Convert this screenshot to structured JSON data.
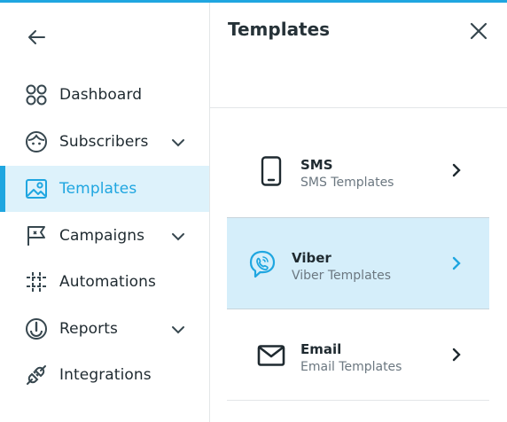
{
  "accent_color": "#1fa6e0",
  "sidebar": {
    "back_icon": "arrow-left-icon",
    "items": [
      {
        "label": "Dashboard",
        "icon": "dashboard-grid-icon",
        "has_submenu": false,
        "active": false
      },
      {
        "label": "Subscribers",
        "icon": "face-icon",
        "has_submenu": true,
        "active": false
      },
      {
        "label": "Templates",
        "icon": "image-template-icon",
        "has_submenu": false,
        "active": true
      },
      {
        "label": "Campaigns",
        "icon": "flag-icon",
        "has_submenu": true,
        "active": false
      },
      {
        "label": "Automations",
        "icon": "automation-icon",
        "has_submenu": false,
        "active": false
      },
      {
        "label": "Reports",
        "icon": "gauge-icon",
        "has_submenu": true,
        "active": false
      },
      {
        "label": "Integrations",
        "icon": "plug-icon",
        "has_submenu": false,
        "active": false
      }
    ]
  },
  "panel": {
    "title": "Templates",
    "close_icon": "close-icon",
    "templates": [
      {
        "name": "SMS",
        "subtitle": "SMS Templates",
        "icon": "phone-icon",
        "selected": false
      },
      {
        "name": "Viber",
        "subtitle": "Viber Templates",
        "icon": "viber-icon",
        "selected": true
      },
      {
        "name": "Email",
        "subtitle": "Email Templates",
        "icon": "envelope-icon",
        "selected": false
      }
    ]
  }
}
